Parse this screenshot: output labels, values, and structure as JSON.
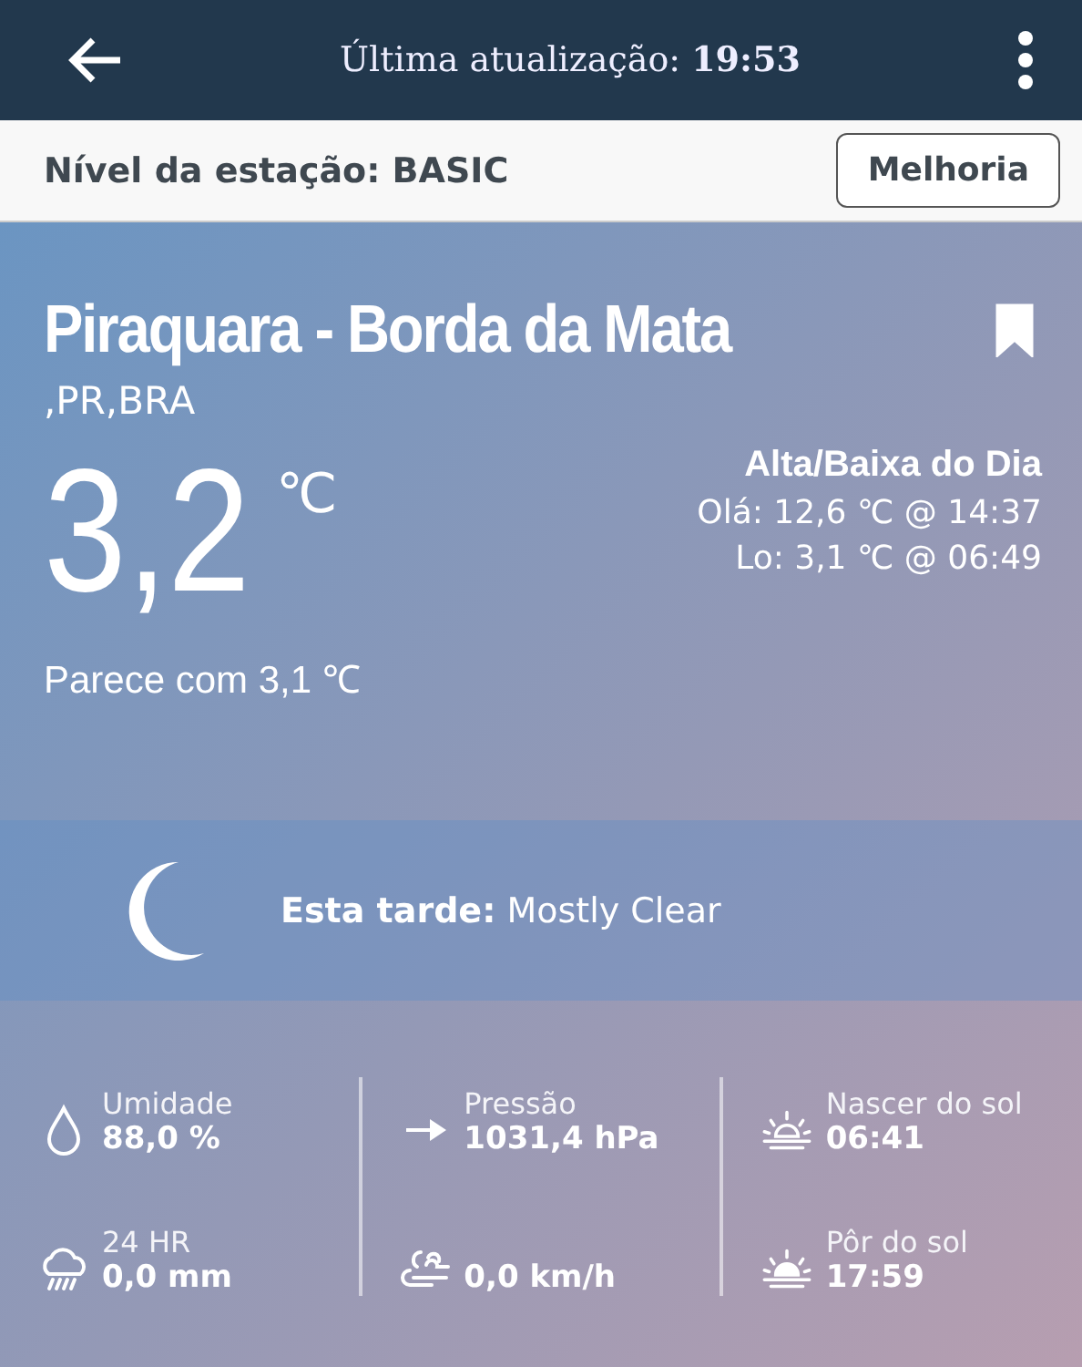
{
  "header": {
    "label": "Última atualização:",
    "time": "19:53"
  },
  "station_bar": {
    "label": "Nível da estação: BASIC",
    "button": "Melhoria"
  },
  "station": {
    "name": "Piraquara - Borda da Mata",
    "region": ",PR,BRA",
    "bookmarked": true
  },
  "current": {
    "temperature": "3,2",
    "unit": "℃",
    "feels_like": "Parece com 3,1 ℃"
  },
  "high_low": {
    "title": "Alta/Baixa do Dia",
    "high": "Olá: 12,6 ℃ @ 14:37",
    "low": "Lo: 3,1 ℃ @ 06:49"
  },
  "forecast": {
    "text": "**Esta tarde:** Mostly Clear"
  },
  "stats": [
    [
      {
        "kind": "drop",
        "label": "Umidade",
        "value": "88,0 %"
      },
      {
        "kind": "rain",
        "label": "24 HR",
        "value": "0,0 mm"
      }
    ],
    [
      {
        "kind": "arrow",
        "label": "Pressão",
        "value": "1031,4 hPa"
      },
      {
        "kind": "wind",
        "value": "0,0 km/h"
      }
    ],
    [
      {
        "kind": "sunrise",
        "label": "Nascer do sol",
        "value": "06:41"
      },
      {
        "kind": "sunset",
        "label": "Pôr do sol",
        "value": "17:59"
      }
    ]
  ]
}
